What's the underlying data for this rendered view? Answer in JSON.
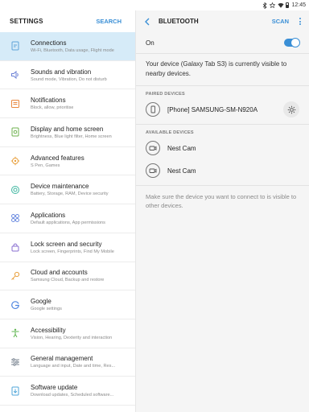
{
  "status_bar": {
    "time": "12:45",
    "icons": [
      "bluetooth-icon",
      "star-icon",
      "wifi-icon",
      "battery-icon"
    ]
  },
  "settings_panel": {
    "title": "SETTINGS",
    "search_label": "SEARCH",
    "items": [
      {
        "title": "Connections",
        "subtitle": "Wi-Fi, Bluetooth, Data usage, Flight mode",
        "icon": "connections-icon",
        "color": "#5fa3d8"
      },
      {
        "title": "Sounds and vibration",
        "subtitle": "Sound mode, Vibration, Do not disturb",
        "icon": "sound-icon",
        "color": "#6c82d6"
      },
      {
        "title": "Notifications",
        "subtitle": "Block, allow, prioritise",
        "icon": "notification-icon",
        "color": "#e9883f"
      },
      {
        "title": "Display and home screen",
        "subtitle": "Brightness, Blue light filter, Home screen",
        "icon": "display-icon",
        "color": "#6eb04e"
      },
      {
        "title": "Advanced features",
        "subtitle": "S Pen, Games",
        "icon": "advanced-features-icon",
        "color": "#e9a13f"
      },
      {
        "title": "Device maintenance",
        "subtitle": "Battery, Storage, RAM, Device security",
        "icon": "maintenance-icon",
        "color": "#3fb6a0"
      },
      {
        "title": "Applications",
        "subtitle": "Default applications, App permissions",
        "icon": "applications-icon",
        "color": "#6b8be0"
      },
      {
        "title": "Lock screen and security",
        "subtitle": "Lock screen, Fingerprints, Find My Mobile",
        "icon": "lock-icon",
        "color": "#8a6fd0"
      },
      {
        "title": "Cloud and accounts",
        "subtitle": "Samsung Cloud, Backup and restore",
        "icon": "key-icon",
        "color": "#e9a13f"
      },
      {
        "title": "Google",
        "subtitle": "Google settings",
        "icon": "google-icon",
        "color": "#4f86e0"
      },
      {
        "title": "Accessibility",
        "subtitle": "Vision, Hearing, Dexterity and interaction",
        "icon": "accessibility-icon",
        "color": "#5fb54f"
      },
      {
        "title": "General management",
        "subtitle": "Language and input, Date and time, Res...",
        "icon": "general-management-icon",
        "color": "#7b8592"
      },
      {
        "title": "Software update",
        "subtitle": "Download updates, Scheduled software...",
        "icon": "software-update-icon",
        "color": "#4fa6d8"
      }
    ]
  },
  "bluetooth_panel": {
    "title": "BLUETOOTH",
    "scan_label": "SCAN",
    "toggle_label": "On",
    "toggle_on": true,
    "visibility_message": "Your device (Galaxy Tab S3) is currently visible to nearby devices.",
    "paired_title": "PAIRED DEVICES",
    "paired_devices": [
      {
        "name": "[Phone] SAMSUNG-SM-N920A",
        "icon": "phone-icon"
      }
    ],
    "available_title": "AVAILABLE DEVICES",
    "available_devices": [
      {
        "name": "Nest Cam",
        "icon": "camera-icon"
      },
      {
        "name": "Nest Cam",
        "icon": "camera-icon"
      }
    ],
    "hint": "Make sure the device you want to connect to is visible to other devices."
  },
  "colors": {
    "accent": "#3a8fd6",
    "selected_bg": "#d6ebf8"
  }
}
